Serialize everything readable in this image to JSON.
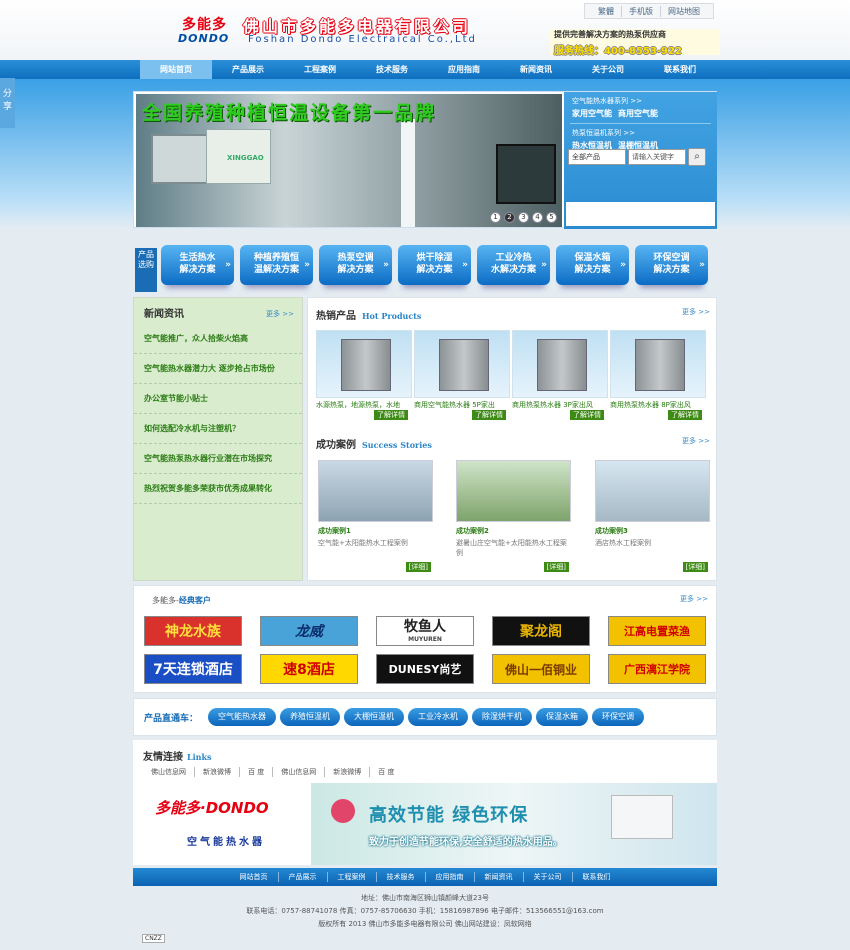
{
  "header": {
    "logo_cn": "多能多",
    "logo_en": "DONDO",
    "company_cn": "佛山市多能多电器有限公司",
    "company_en": "Foshan Dondo Electraical Co.,Ltd",
    "top_links": [
      "繁體",
      "手机版",
      "网站地图"
    ],
    "slogan": "提供完善解决方案的热泵供应商",
    "hotline": "服务热线：400-8553-922"
  },
  "nav": {
    "items": [
      "网站首页",
      "产品展示",
      "工程案例",
      "技术服务",
      "应用指南",
      "新闻资讯",
      "关于公司",
      "联系我们"
    ],
    "active": "网站首页"
  },
  "share": "分享",
  "banner": {
    "slide_text": "全国养殖种植恒温设备第一品牌",
    "slide_brand": "XINGGAO",
    "dots": [
      "1",
      "2",
      "3",
      "4",
      "5"
    ],
    "series1": "空气能热水器系列",
    "series1_items": [
      "家用空气能",
      "商用空气能"
    ],
    "series2": "热泵恒温机系列",
    "series2_items": [
      "热水恒温机",
      "温棚恒温机"
    ],
    "more_mark": ">>",
    "select_value": "全部产品",
    "search_placeholder": "请输入关键字"
  },
  "solutions": {
    "label": "产品选购",
    "items": [
      [
        "生活热水",
        "解决方案"
      ],
      [
        "种植养殖恒",
        "温解决方案"
      ],
      [
        "热泵空调",
        "解决方案"
      ],
      [
        "烘干除湿",
        "解决方案"
      ],
      [
        "工业冷热",
        "水解决方案"
      ],
      [
        "保温水箱",
        "解决方案"
      ],
      [
        "环保空调",
        "解决方案"
      ]
    ]
  },
  "news": {
    "title": "新闻资讯",
    "more": "更多 >>",
    "items": [
      "空气能推广，众人拾柴火焰高",
      "空气能热水器潜力大 逐步抢占市场份",
      "办公室节能小贴士",
      "如何选配冷水机与注塑机？",
      "空气能热泵热水器行业潜在市场探究",
      "热烈祝贺多能多荣获市优秀成果转化"
    ]
  },
  "hot_products": {
    "title": "热销产品",
    "title_en": "Hot Products",
    "more": "更多 >>",
    "detail_label": "了解详情",
    "items": [
      "水源热泵，地源热泵，水地",
      "商用空气能热水器 5P家出",
      "商用热泵热水器 3P家出风",
      "商用热泵热水器 8P家出风"
    ]
  },
  "success": {
    "title": "成功案例",
    "title_en": "Success Stories",
    "more": "更多 >>",
    "detail_label": "[详细]",
    "items": [
      {
        "name": "成功案例1",
        "desc": "空气能+太阳能热水工程案例"
      },
      {
        "name": "成功案例2",
        "desc": "避暑山庄空气能+太阳能热水工程案例"
      },
      {
        "name": "成功案例3",
        "desc": "酒店热水工程案例"
      }
    ]
  },
  "clients": {
    "prefix": "多能多-",
    "title": "经典客户",
    "more": "更多 >>",
    "logos": [
      "神龙水族",
      "龙威",
      "牧鱼人",
      "聚龙阁",
      "江高电置菜渔",
      "7天连锁酒店",
      "速8酒店",
      "DUNESY尚艺",
      "佛山一佰铜业",
      "广西漓江学院"
    ],
    "logo_sub": "MUYUREN"
  },
  "direct": {
    "label": "产品直通车：",
    "items": [
      "空气能热水器",
      "养殖恒温机",
      "大棚恒温机",
      "工业冷水机",
      "除湿烘干机",
      "保温水箱",
      "环保空调"
    ]
  },
  "links": {
    "title": "友情连接",
    "title_en": "Links",
    "items": [
      "佛山信息网",
      "新浪微博",
      "百 度",
      "佛山信息网",
      "新浪微博",
      "百 度"
    ]
  },
  "ad": {
    "brand": "多能多·DONDO",
    "product": "空气能热水器",
    "headline": "高效节能  绿色环保",
    "tagline": "致力于创造节能环保,安全舒适的热水用品。"
  },
  "footer": {
    "nav": [
      "网站首页",
      "产品展示",
      "工程案例",
      "技术服务",
      "应用指南",
      "新闻资讯",
      "关于公司",
      "联系我们"
    ],
    "address": "地址：佛山市南海区狮山镇颜峰大道23号",
    "contact": "联系电话：0757-88741078  传真：0757-85706630  手机：15816987896  电子邮件：513566551@163.com",
    "copyright": "版权所有 2013 佛山市多能多电器有限公司  佛山网站建设：凤软网络",
    "badge": "CNZZ"
  },
  "colors": {
    "nav_blue": "#0f6fbf",
    "accent_green": "#2b7d14",
    "brand_red": "#e60012"
  }
}
